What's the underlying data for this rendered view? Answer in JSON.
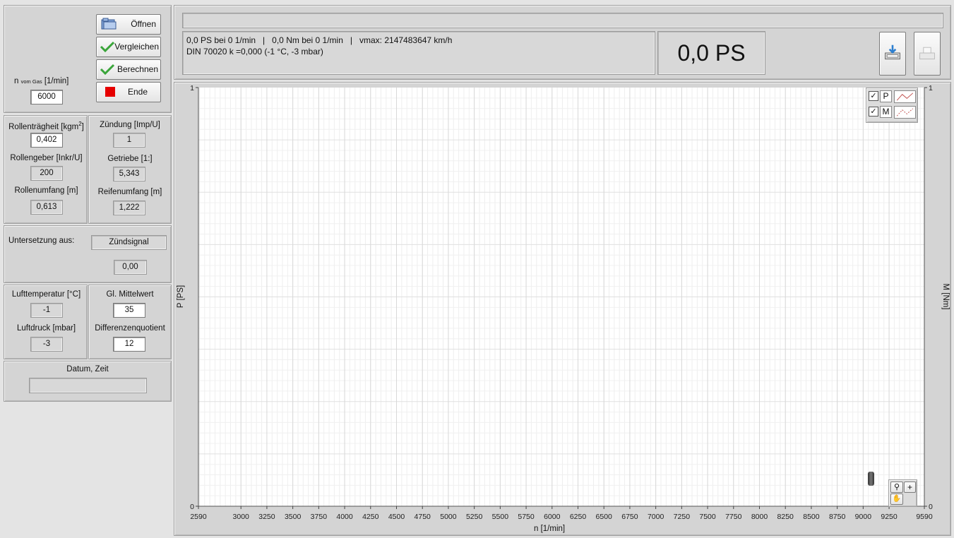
{
  "controls": {
    "n_label_main": "n",
    "n_label_sub": "vom Gas",
    "n_label_unit": "[1/min]",
    "n_value": "6000",
    "buttons": {
      "open": "Öffnen",
      "compare": "Vergleichen",
      "calculate": "Berechnen",
      "end": "Ende"
    }
  },
  "params_left": {
    "roll_inertia_label": "Rollenträgheit [kgm",
    "roll_inertia_sup": "2",
    "roll_inertia_close": "]",
    "roll_inertia_value": "0,402",
    "roll_encoder_label": "Rollengeber [Inkr/U]",
    "roll_encoder_value": "200",
    "roll_circ_label": "Rollenumfang [m]",
    "roll_circ_value": "0,613"
  },
  "params_right": {
    "ignition_label": "Zündung [Imp/U]",
    "ignition_value": "1",
    "gearbox_label": "Getriebe [1:]",
    "gearbox_value": "5,343",
    "tire_circ_label": "Reifenumfang [m]",
    "tire_circ_value": "1,222"
  },
  "reduction": {
    "label": "Untersetzung aus:",
    "source_value": "Zündsignal",
    "value": "0,00"
  },
  "environment": {
    "air_temp_label": "Lufttemperatur [°C]",
    "air_temp_value": "-1",
    "air_pressure_label": "Luftdruck [mbar]",
    "air_pressure_value": "-3"
  },
  "smoothing": {
    "mean_label": "Gl. Mittelwert",
    "mean_value": "35",
    "diff_label": "Differenzenquotient",
    "diff_value": "12"
  },
  "datetime": {
    "label": "Datum, Zeit",
    "value": ""
  },
  "status": {
    "line1": "0,0 PS bei 0 1/min   |   0,0 Nm bei 0 1/min   |   vmax: 2147483647 km/h",
    "line2": "DIN 70020 k =0,000 (-1 °C, -3 mbar)",
    "power_display": "0,0 PS",
    "top_bar_text": ""
  },
  "chart_data": {
    "type": "line",
    "xlabel": "n [1/min]",
    "ylabel": "P [PS]",
    "y2label": "M [Nm]",
    "xlim": [
      2590,
      9590
    ],
    "ylim": [
      0,
      1
    ],
    "y2lim": [
      0,
      1
    ],
    "x_ticks": [
      "2590",
      "3000",
      "3250",
      "3500",
      "3750",
      "4000",
      "4250",
      "4500",
      "4750",
      "5000",
      "5250",
      "5500",
      "5750",
      "6000",
      "6250",
      "6500",
      "6750",
      "7000",
      "7250",
      "7500",
      "7750",
      "8000",
      "8250",
      "8500",
      "8750",
      "9000",
      "9250",
      "9590"
    ],
    "y_ticks": [
      "0",
      "1"
    ],
    "y2_ticks": [
      "0",
      "1"
    ],
    "grid": true,
    "legend_position": "top-right",
    "series": [
      {
        "name": "P",
        "visible": true,
        "color": "#c0504d",
        "values": []
      },
      {
        "name": "M",
        "visible": true,
        "color": "#c0504d",
        "values": []
      }
    ]
  },
  "colors": {
    "end_button_square": "#e60000",
    "check_icon": "#3aa53a",
    "folder_icon": "#6a8fc8"
  }
}
